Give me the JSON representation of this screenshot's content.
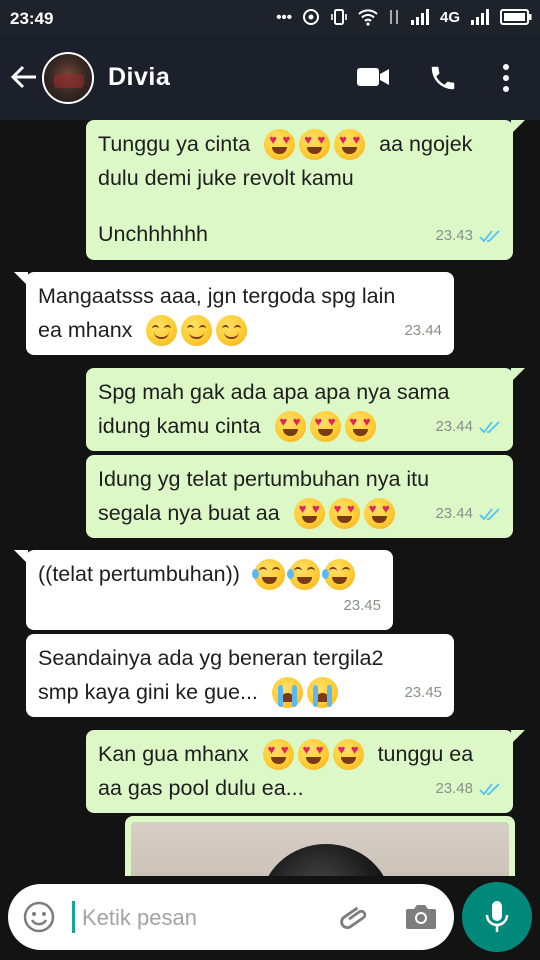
{
  "status_bar": {
    "time": "23:49",
    "network": "4G"
  },
  "header": {
    "contact_name": "Divia"
  },
  "messages": [
    {
      "direction": "out",
      "lines": [
        {
          "text": "Tunggu ya cinta",
          "emojis": [
            "heart-eyes",
            "heart-eyes",
            "heart-eyes"
          ],
          "after": "aa ngojek"
        },
        {
          "text": "dulu demi juke revolt kamu"
        },
        {
          "text": ""
        },
        {
          "text": "Unchhhhhh"
        }
      ],
      "time": "23.43",
      "read": true
    },
    {
      "direction": "in",
      "lines": [
        {
          "text": "Mangaatsss aaa, jgn tergoda spg lain"
        },
        {
          "text": "ea mhanx",
          "emojis": [
            "relieved",
            "smiling",
            "smiling"
          ]
        }
      ],
      "time": "23.44"
    },
    {
      "direction": "out",
      "lines": [
        {
          "text": "Spg mah gak ada apa apa nya sama"
        },
        {
          "text": "idung kamu cinta",
          "emojis": [
            "heart-eyes",
            "heart-eyes",
            "heart-eyes"
          ]
        }
      ],
      "time": "23.44",
      "read": true
    },
    {
      "direction": "out",
      "lines": [
        {
          "text": "Idung yg telat pertumbuhan nya itu"
        },
        {
          "text": "segala nya buat aa",
          "emojis": [
            "heart-eyes",
            "heart-eyes",
            "heart-eyes"
          ]
        }
      ],
      "time": "23.44",
      "read": true
    },
    {
      "direction": "in",
      "lines": [
        {
          "text": "((telat pertumbuhan))",
          "emojis": [
            "joy",
            "joy",
            "joy"
          ]
        }
      ],
      "time": "23.45"
    },
    {
      "direction": "in",
      "lines": [
        {
          "text": "Seandainya ada yg beneran tergila2"
        },
        {
          "text": "smp kaya gini ke gue...",
          "emojis": [
            "sob",
            "sob"
          ]
        }
      ],
      "time": "23.45"
    },
    {
      "direction": "out",
      "lines": [
        {
          "text": "Kan gua mhanx",
          "emojis": [
            "heart-eyes",
            "heart-eyes",
            "heart-eyes"
          ],
          "after": "tunggu ea"
        },
        {
          "text": "aa gas pool dulu ea..."
        }
      ],
      "time": "23.48",
      "read": true
    }
  ],
  "composer": {
    "placeholder": "Ketik pesan"
  },
  "icons": {
    "back": "arrow-left-icon",
    "video": "video-camera-icon",
    "call": "phone-icon",
    "menu": "more-vertical-icon",
    "emoji": "smile-icon",
    "attach": "paperclip-icon",
    "camera": "camera-icon",
    "mic": "microphone-icon"
  },
  "colors": {
    "header": "#1c202a",
    "chat_background": "#131313",
    "outgoing_bubble": "#dcf8c6",
    "incoming_bubble": "#ffffff",
    "read_ticks": "#4fc3f7",
    "mic_button": "#00897b"
  }
}
